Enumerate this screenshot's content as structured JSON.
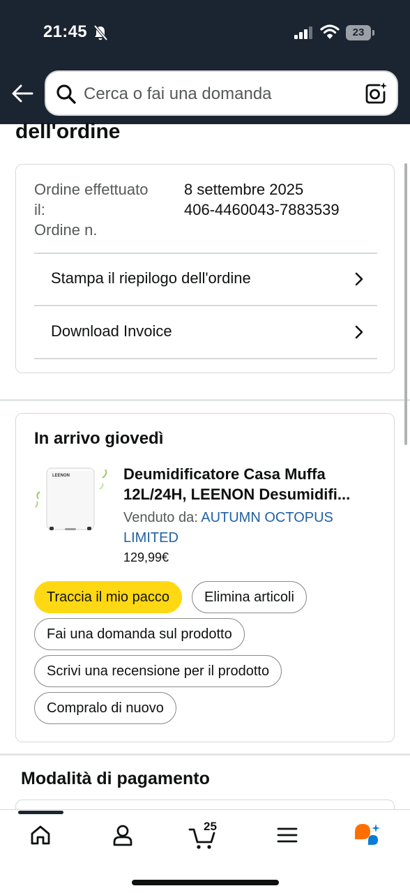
{
  "status_bar": {
    "time": "21:45",
    "battery": "23"
  },
  "search": {
    "placeholder": "Cerca o fai una domanda"
  },
  "page": {
    "title_fragment": "dell'ordine"
  },
  "order_info": {
    "date_label_line1": "Ordine effettuato",
    "date_label_line2": "il:",
    "date_value": "8 settembre 2025",
    "number_label": "Ordine n.",
    "number_value": "406-4460043-7883539",
    "links": [
      {
        "label": "Stampa il riepilogo dell'ordine"
      },
      {
        "label": "Download Invoice"
      }
    ]
  },
  "shipment": {
    "title": "In arrivo giovedì",
    "product": {
      "title_line1": "Deumidificatore Casa Muffa",
      "title_line2": "12L/24H, LEENON Desumidifi...",
      "sold_by_label": "Venduto da:",
      "seller": "AUTUMN OCTOPUS LIMITED",
      "price": "129,99€",
      "image_brand": "LEENON"
    },
    "actions": {
      "track": "Traccia il mio pacco",
      "remove": "Elimina articoli",
      "ask": "Fai una domanda sul prodotto",
      "review": "Scrivi una recensione per il prodotto",
      "buy_again": "Compralo di nuovo"
    }
  },
  "payment": {
    "title": "Modalità di pagamento"
  },
  "bottom_nav": {
    "cart_count": "25",
    "items": [
      "home-icon",
      "account-icon",
      "cart-icon",
      "menu-icon",
      "rufus-icon"
    ]
  },
  "colors": {
    "header_bg": "#1b2431",
    "primary_button": "#ffd814",
    "link": "#2162a1",
    "rufus_orange": "#ff6f00",
    "rufus_blue": "#0a7bd6"
  }
}
